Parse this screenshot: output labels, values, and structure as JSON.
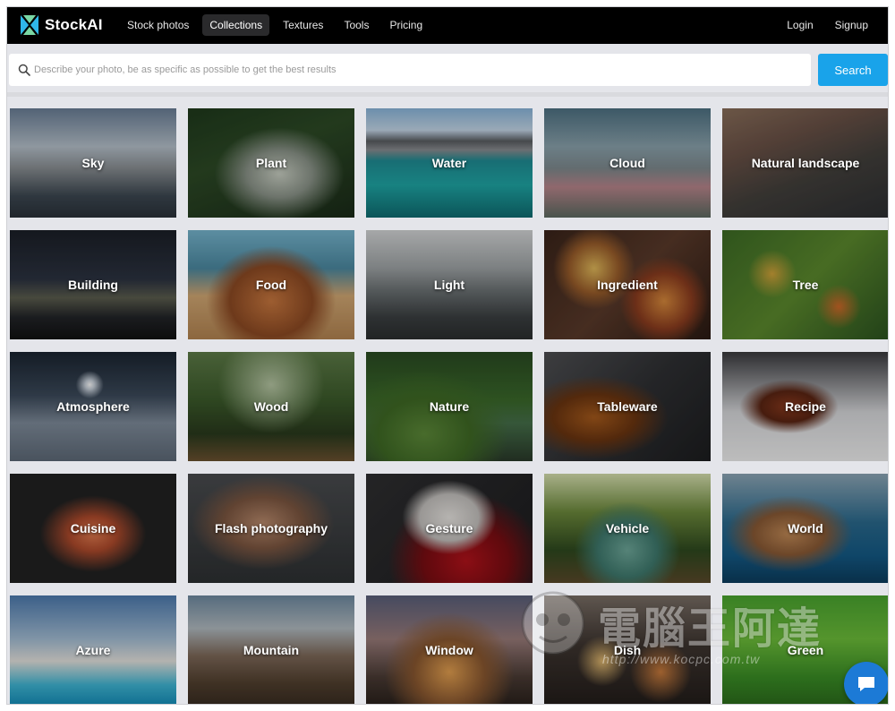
{
  "brand": {
    "name": "StockAI",
    "accent_color": "#19a3ea",
    "logo_colors": [
      "#2fb7e8",
      "#7ad8a5"
    ]
  },
  "nav": {
    "links": [
      {
        "label": "Stock photos",
        "active": false
      },
      {
        "label": "Collections",
        "active": true
      },
      {
        "label": "Textures",
        "active": false
      },
      {
        "label": "Tools",
        "active": false
      },
      {
        "label": "Pricing",
        "active": false
      }
    ],
    "login_label": "Login",
    "signup_label": "Signup"
  },
  "search": {
    "placeholder": "Describe your photo, be as specific as possible to get the best results",
    "value": "",
    "button_label": "Search",
    "icon": "search-icon"
  },
  "collections": [
    {
      "label": "Sky"
    },
    {
      "label": "Plant"
    },
    {
      "label": "Water"
    },
    {
      "label": "Cloud"
    },
    {
      "label": "Natural landscape"
    },
    {
      "label": "Building"
    },
    {
      "label": "Food"
    },
    {
      "label": "Light"
    },
    {
      "label": "Ingredient"
    },
    {
      "label": "Tree"
    },
    {
      "label": "Atmosphere"
    },
    {
      "label": "Wood"
    },
    {
      "label": "Nature"
    },
    {
      "label": "Tableware"
    },
    {
      "label": "Recipe"
    },
    {
      "label": "Cuisine"
    },
    {
      "label": "Flash photography"
    },
    {
      "label": "Gesture"
    },
    {
      "label": "Vehicle"
    },
    {
      "label": "World"
    },
    {
      "label": "Azure"
    },
    {
      "label": "Mountain"
    },
    {
      "label": "Window"
    },
    {
      "label": "Dish"
    },
    {
      "label": "Green"
    }
  ],
  "watermark": {
    "text": "電腦王阿達",
    "url": "http://www.kocpc.com.tw"
  },
  "chat": {
    "icon": "chat-bubble-icon",
    "color": "#1c7ad6"
  }
}
